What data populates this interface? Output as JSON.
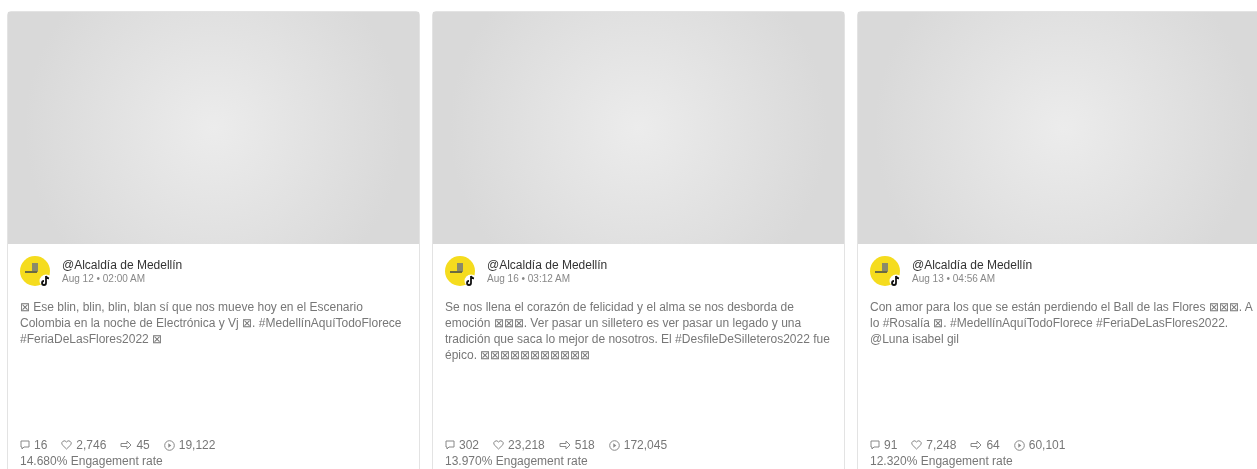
{
  "posts": [
    {
      "author": "@Alcaldía de Medellín",
      "date": "Aug 12 • 02:00 AM",
      "text": "⊠ Ese blin, blin, blin, blan sí que nos mueve hoy en el Escenario Colombia en la noche de Electrónica y Vj ⊠. #MedellínAquíTodoFlorece #FeriaDeLasFlores2022 ⊠",
      "comments": "16",
      "likes": "2,746",
      "shares": "45",
      "views": "19,122",
      "engagement": "14.680% Engagement rate"
    },
    {
      "author": "@Alcaldía de Medellín",
      "date": "Aug 16 • 03:12 AM",
      "text": "Se nos llena el corazón de felicidad y el alma se nos desborda de emoción ⊠⊠⊠. Ver pasar un silletero es ver pasar un legado y una tradición que saca lo mejor de nosotros.  El #DesfileDeSilleteros2022 fue épico. ⊠⊠⊠⊠⊠⊠⊠⊠⊠⊠⊠",
      "comments": "302",
      "likes": "23,218",
      "shares": "518",
      "views": "172,045",
      "engagement": "13.970% Engagement rate"
    },
    {
      "author": "@Alcaldía de Medellín",
      "date": "Aug 13 • 04:56 AM",
      "text": "Con amor para los que se están perdiendo el Ball de las Flores ⊠⊠⊠. A lo #Rosalía ⊠. #MedellínAquíTodoFlorece #FeriaDeLasFlores2022. @Luna isabel gil",
      "comments": "91",
      "likes": "7,248",
      "shares": "64",
      "views": "60,101",
      "engagement": "12.320% Engagement rate"
    }
  ]
}
